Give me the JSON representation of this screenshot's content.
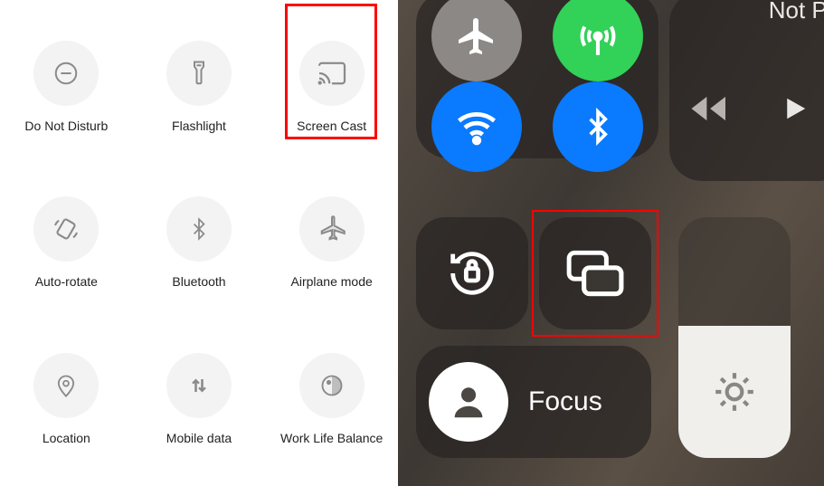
{
  "android": {
    "tiles": [
      {
        "id": "dnd",
        "label": "Do Not Disturb",
        "icon": "dnd-icon"
      },
      {
        "id": "flashlight",
        "label": "Flashlight",
        "icon": "flashlight-icon"
      },
      {
        "id": "screencast",
        "label": "Screen Cast",
        "icon": "cast-icon",
        "highlighted": true
      },
      {
        "id": "autorotate",
        "label": "Auto-rotate",
        "icon": "rotate-icon"
      },
      {
        "id": "bluetooth",
        "label": "Bluetooth",
        "icon": "bluetooth-icon"
      },
      {
        "id": "airplane",
        "label": "Airplane mode",
        "icon": "airplane-icon"
      },
      {
        "id": "location",
        "label": "Location",
        "icon": "location-icon"
      },
      {
        "id": "mobiledata",
        "label": "Mobile data",
        "icon": "data-icon"
      },
      {
        "id": "worklife",
        "label": "Work Life Balance",
        "icon": "worklife-icon"
      }
    ]
  },
  "ios": {
    "connectivity": {
      "airplane": {
        "active": false,
        "color": "#8c8885"
      },
      "cellular": {
        "active": true,
        "color": "#32d158"
      },
      "wifi": {
        "active": true,
        "color": "#0a7aff"
      },
      "bluetooth": {
        "active": true,
        "color": "#0a7aff"
      }
    },
    "media": {
      "status": "Not Pla"
    },
    "focus": {
      "label": "Focus"
    },
    "brightness": {
      "level_pct": 55
    },
    "mirror_highlighted": true
  }
}
